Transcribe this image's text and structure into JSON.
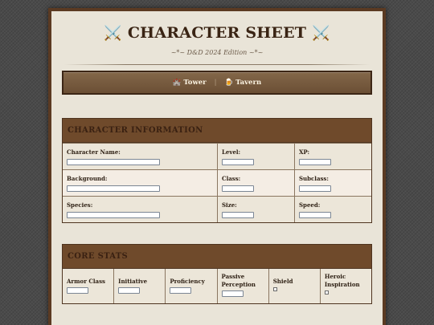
{
  "header": {
    "title": "CHARACTER SHEET",
    "sword_glyph": "⚔️",
    "subtitle": "~*~ D&D 2024 Edition ~*~"
  },
  "nav": {
    "tower": {
      "icon": "castle-icon",
      "glyph": "🏰",
      "label": "Tower"
    },
    "separator": "|",
    "tavern": {
      "icon": "beer-mug-icon",
      "glyph": "🍺",
      "label": "Tavern"
    }
  },
  "character_info": {
    "heading": "CHARACTER INFORMATION",
    "fields": {
      "name": "Character Name:",
      "level": "Level:",
      "xp": "XP:",
      "background": "Background:",
      "class": "Class:",
      "subclass": "Subclass:",
      "species": "Species:",
      "size": "Size:",
      "speed": "Speed:"
    }
  },
  "core_stats": {
    "heading": "CORE STATS",
    "fields": {
      "armor_class": "Armor Class",
      "initiative": "Initiative",
      "proficiency": "Proficiency",
      "passive_perception": "Passive Perception",
      "shield": "Shield",
      "heroic_inspiration": "Heroic Inspiration"
    }
  },
  "colors": {
    "page_bg": "#e9e4d8",
    "nav_bg": "#6b4f35",
    "section_header": "#6f4a2b",
    "frame": "#5b3a22"
  }
}
